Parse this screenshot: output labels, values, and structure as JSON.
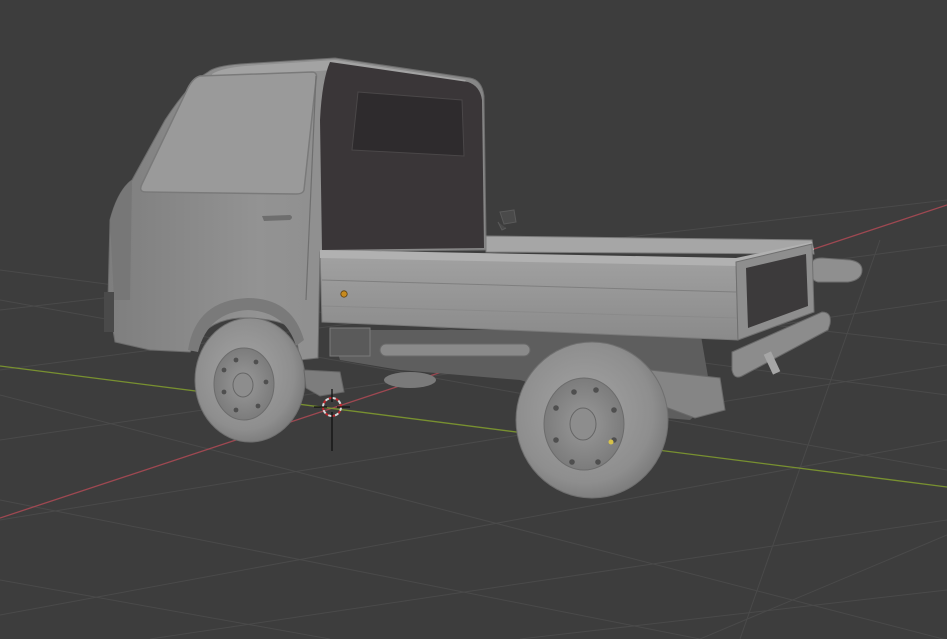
{
  "viewport": {
    "type": "3d-viewport",
    "background_color": "#3d3d3d",
    "grid_line_color": "#4a4a4a",
    "x_axis_color": "#b04a55",
    "y_axis_color": "#7f9a2f",
    "show_grid": true
  },
  "scene": {
    "object": "truck",
    "material": "clay",
    "body_color": "#8d8d8d",
    "cabin_window_color": "#3a3638",
    "origin_marker": "3d-cursor"
  }
}
